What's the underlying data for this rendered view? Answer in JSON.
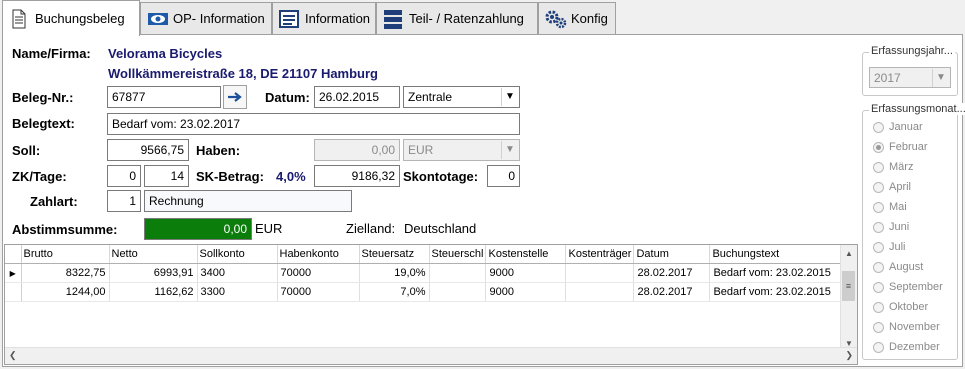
{
  "tabs": [
    {
      "label": "Buchungsbeleg",
      "icon": "document-icon"
    },
    {
      "label": "OP- Information",
      "icon": "eye-icon"
    },
    {
      "label": "Information",
      "icon": "list-window-icon"
    },
    {
      "label": "Teil- / Ratenzahlung",
      "icon": "stack-icon"
    },
    {
      "label": "Konfig",
      "icon": "gears-icon"
    }
  ],
  "form": {
    "name_label": "Name/Firma:",
    "company": "Velorama Bicycles",
    "address": "Wollkämmereistraße 18, DE 21107 Hamburg",
    "beleg_label": "Beleg-Nr.:",
    "beleg_value": "67877",
    "datum_label": "Datum:",
    "datum_value": "26.02.2015",
    "location_value": "Zentrale",
    "belegtext_label": "Belegtext:",
    "belegtext_value": "Bedarf vom: 23.02.2017",
    "soll_label": "Soll:",
    "soll_value": "9566,75",
    "haben_label": "Haben:",
    "haben_value": "0,00",
    "currency_value": "EUR",
    "zk_label": "ZK/Tage:",
    "zk_value": "0",
    "tage_value": "14",
    "sk_label": "SK-Betrag:",
    "sk_percent": "4,0%",
    "sk_value": "9186,32",
    "skontotage_label": "Skontotage:",
    "skontotage_value": "0",
    "zahlart_label": "Zahlart:",
    "zahlart_code": "1",
    "zahlart_text": "Rechnung",
    "abstimm_label": "Abstimmsumme:",
    "abstimm_value": "0,00",
    "abstimm_currency": "EUR",
    "zielland_label": "Zielland:",
    "zielland_value": "Deutschland"
  },
  "grid": {
    "columns": [
      "Brutto",
      "Netto",
      "Sollkonto",
      "Habenkonto",
      "Steuersatz",
      "Steuerschl",
      "Kostenstelle",
      "Kostenträger",
      "Datum",
      "Buchungstext"
    ],
    "rows": [
      [
        "8322,75",
        "6993,91",
        "3400",
        "70000",
        "19,0%",
        "",
        "9000",
        "",
        "28.02.2017",
        "Bedarf vom: 23.02.2015"
      ],
      [
        "1244,00",
        "1162,62",
        "3300",
        "70000",
        "7,0%",
        "",
        "9000",
        "",
        "28.02.2017",
        "Bedarf vom: 23.02.2015"
      ]
    ]
  },
  "sidebar": {
    "year_title": "Erfassungsjahr...",
    "year_value": "2017",
    "month_title": "Erfassungsmonat...",
    "months": [
      "Januar",
      "Februar",
      "März",
      "April",
      "Mai",
      "Juni",
      "Juli",
      "August",
      "September",
      "Oktober",
      "November",
      "Dezember"
    ],
    "selected_month": "Februar"
  },
  "colors": {
    "company": "#1a1a6e",
    "abstimm_bg": "#0a7d0a",
    "sk_percent": "#1a1a6e"
  }
}
